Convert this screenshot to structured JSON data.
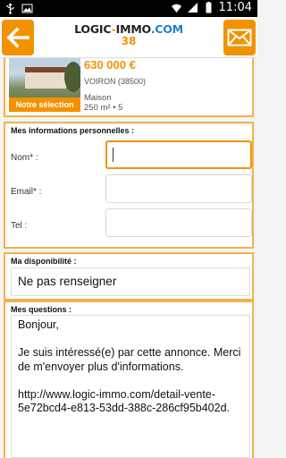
{
  "status_bar": {
    "time": "11:04",
    "icons": [
      "usb-icon",
      "image-icon",
      "wifi-icon",
      "signal-icon",
      "battery-icon"
    ]
  },
  "app_bar": {
    "logo_part1": "LOGIC",
    "logo_dash": "-",
    "logo_part2": "IMMO",
    "logo_part3": ".COM",
    "department": "38",
    "accent_color": "#f39200"
  },
  "listing": {
    "price": "630 000 €",
    "city": "VOIRON (38500)",
    "type": "Maison",
    "details": "250 m² • 5",
    "badge": "Notre sélection"
  },
  "personal_info": {
    "title": "Mes informations personnelles :",
    "fields": [
      {
        "label": "Nom* :",
        "value": ""
      },
      {
        "label": "Email* :",
        "value": ""
      },
      {
        "label": "Tel :",
        "value": ""
      }
    ]
  },
  "availability": {
    "title": "Ma disponibilité :",
    "selected": "Ne pas renseigner"
  },
  "questions": {
    "title": "Mes questions :",
    "message": "Bonjour,\n\nJe suis intéressé(e) par cette annonce. Merci de m'envoyer plus d'informations.\n\nhttp://www.logic-immo.com/detail-vente-5e72bcd4-e813-53dd-388c-286cf95b402d."
  }
}
